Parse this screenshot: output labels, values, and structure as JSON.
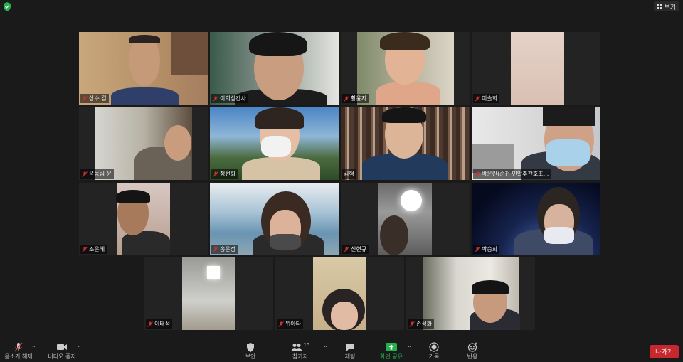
{
  "topbar": {
    "view_label": "보기"
  },
  "participants": [
    {
      "name": "상수 김",
      "muted": true
    },
    {
      "name": "이희성간사",
      "muted": true
    },
    {
      "name": "황윤지",
      "muted": true
    },
    {
      "name": "이슬희",
      "muted": true
    },
    {
      "name": "윤동림 윤",
      "muted": true
    },
    {
      "name": "정선화",
      "muted": true
    },
    {
      "name": "김혁",
      "muted": false,
      "active_speaker": true
    },
    {
      "name": "박은란(순천 민알추간호초...",
      "muted": true
    },
    {
      "name": "조은혜",
      "muted": true
    },
    {
      "name": "송은정",
      "muted": true
    },
    {
      "name": "신현규",
      "muted": true
    },
    {
      "name": "박승희",
      "muted": true
    },
    {
      "name": "이태성",
      "muted": true
    },
    {
      "name": "위아타",
      "muted": true
    },
    {
      "name": "손성화",
      "muted": true
    }
  ],
  "toolbar": {
    "mute_label": "음소거 해제",
    "video_label": "비디오 중지",
    "security_label": "보안",
    "participants_label": "참가자",
    "participants_count": "15",
    "chat_label": "채팅",
    "share_label": "화면 공유",
    "record_label": "기록",
    "reactions_label": "반응",
    "leave_label": "나가기"
  },
  "colors": {
    "active_border": "#c8d63c",
    "share_green": "#22b14c",
    "leave_red": "#c7272f",
    "muted_red": "#d0312d"
  }
}
